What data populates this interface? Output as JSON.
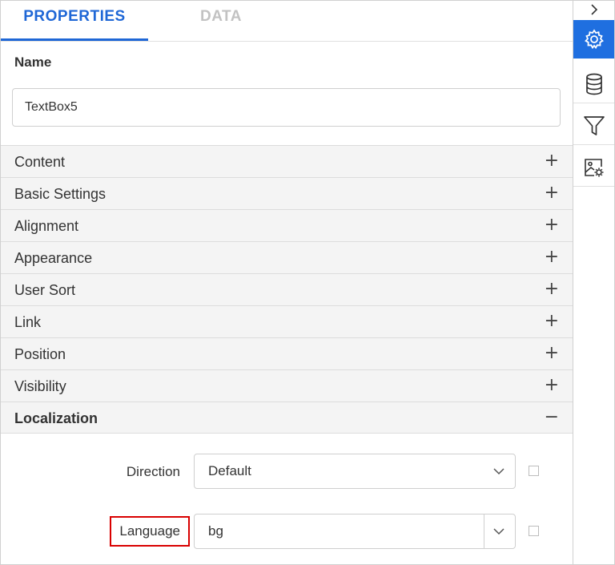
{
  "tabs": [
    {
      "label": "PROPERTIES",
      "active": true
    },
    {
      "label": "DATA",
      "active": false
    }
  ],
  "name_section": {
    "label": "Name",
    "value": "TextBox5"
  },
  "accordion": [
    {
      "label": "Content",
      "toggle": "+"
    },
    {
      "label": "Basic Settings",
      "toggle": "+"
    },
    {
      "label": "Alignment",
      "toggle": "+"
    },
    {
      "label": "Appearance",
      "toggle": "+"
    },
    {
      "label": "User Sort",
      "toggle": "+"
    },
    {
      "label": "Link",
      "toggle": "+"
    },
    {
      "label": "Position",
      "toggle": "+"
    },
    {
      "label": "Visibility",
      "toggle": "+"
    },
    {
      "label": "Localization",
      "toggle": "−",
      "expanded": true
    }
  ],
  "localization": {
    "direction": {
      "label": "Direction",
      "value": "Default"
    },
    "language": {
      "label": "Language",
      "value": "bg"
    }
  },
  "sidebar": {
    "items": [
      {
        "icon": "collapse-chevron-right-icon"
      },
      {
        "icon": "gear-icon",
        "active": true
      },
      {
        "icon": "database-icon"
      },
      {
        "icon": "filter-icon"
      },
      {
        "icon": "image-settings-icon"
      }
    ]
  },
  "colors": {
    "accent": "#1f67d6",
    "active_button": "#1f6fe0",
    "highlight_border": "#d90000",
    "section_bg": "#f4f4f4"
  }
}
